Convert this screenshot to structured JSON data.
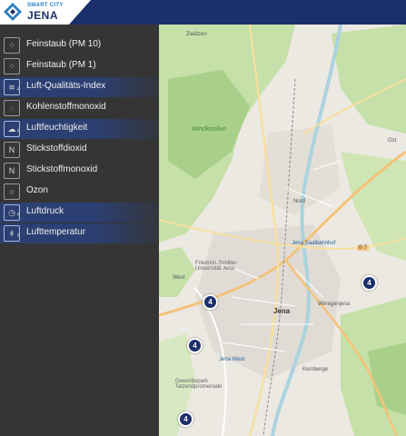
{
  "header": {
    "logo_small": "SMART CITY",
    "logo_big": "JENA"
  },
  "sidebar": {
    "items": [
      {
        "label": "Feinstaub (PM 10)",
        "icon": "particulate-icon",
        "sub": "",
        "active": false
      },
      {
        "label": "Feinstaub (PM 1)",
        "icon": "particulate-icon",
        "sub": "",
        "active": false
      },
      {
        "label": "Luft-Qualitäts-Index",
        "icon": "air-quality-icon",
        "sub": "4",
        "active": true
      },
      {
        "label": "Kohlenstoffmonoxid",
        "icon": "co-icon",
        "sub": "",
        "active": false
      },
      {
        "label": "Luftfeuchtigkeit",
        "icon": "humidity-icon",
        "sub": "4",
        "active": true
      },
      {
        "label": "Stickstoffdioxid",
        "icon": "no2-icon",
        "sub": "",
        "active": false
      },
      {
        "label": "Stickstoffmonoxid",
        "icon": "no-icon",
        "sub": "",
        "active": false
      },
      {
        "label": "Ozon",
        "icon": "ozone-icon",
        "sub": "",
        "active": false
      },
      {
        "label": "Luftdruck",
        "icon": "pressure-icon",
        "sub": "4",
        "active": true
      },
      {
        "label": "Lufttemperatur",
        "icon": "thermometer-icon",
        "sub": "4",
        "active": true
      }
    ]
  },
  "map": {
    "labels": {
      "windknollen": "Windknollen",
      "nord": "Nord",
      "west": "West",
      "jena": "Jena",
      "wenigenjena": "Wenigenjena",
      "jena_west": "Jena West",
      "jena_saalbahnhof": "Jena Saalbahnhof",
      "kernberge": "Kernberge",
      "b7": "B 7",
      "schiller": "Friedrich-Schiller-Universität Jena",
      "gewerbepark": "Gewerbepark Tatzendpromenade",
      "ost": "Ost",
      "zwaetzen": "Zwätzen"
    },
    "markers": [
      {
        "count": "4"
      },
      {
        "count": "4"
      },
      {
        "count": "4"
      },
      {
        "count": "4"
      }
    ]
  }
}
